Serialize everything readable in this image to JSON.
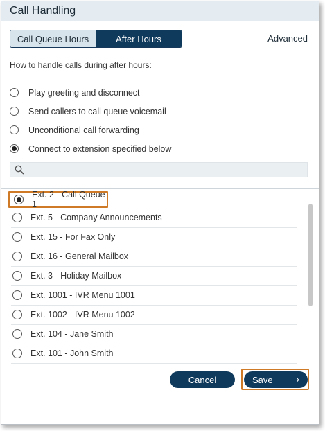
{
  "dialog": {
    "title": "Call Handling"
  },
  "tabs": [
    {
      "label": "Call Queue Hours",
      "active": false
    },
    {
      "label": "After Hours",
      "active": true
    }
  ],
  "advanced_link": "Advanced",
  "prompt": "How to handle calls during after hours:",
  "options": [
    {
      "label": "Play greeting and disconnect",
      "selected": false
    },
    {
      "label": "Send callers to call queue voicemail",
      "selected": false
    },
    {
      "label": "Unconditional call forwarding",
      "selected": false
    },
    {
      "label": "Connect to extension specified below",
      "selected": true
    }
  ],
  "search": {
    "placeholder": "",
    "value": "",
    "icon": "search-icon"
  },
  "extensions": [
    {
      "label": "Ext. 2 - Call Queue 1",
      "selected": true
    },
    {
      "label": "Ext. 5 - Company Announcements",
      "selected": false
    },
    {
      "label": "Ext. 15 - For Fax Only",
      "selected": false
    },
    {
      "label": "Ext. 16 - General Mailbox",
      "selected": false
    },
    {
      "label": "Ext. 3 - Holiday Mailbox",
      "selected": false
    },
    {
      "label": "Ext. 1001 - IVR Menu 1001",
      "selected": false
    },
    {
      "label": "Ext. 1002 - IVR Menu 1002",
      "selected": false
    },
    {
      "label": "Ext. 104 - Jane Smith",
      "selected": false
    },
    {
      "label": "Ext. 101 - John Smith",
      "selected": false
    }
  ],
  "footer": {
    "cancel_label": "Cancel",
    "save_label": "Save",
    "save_icon": "chevron-right-icon"
  },
  "colors": {
    "primary": "#0f3a5c",
    "highlight": "#cf7a26",
    "titlebar": "#e4ecf2"
  }
}
